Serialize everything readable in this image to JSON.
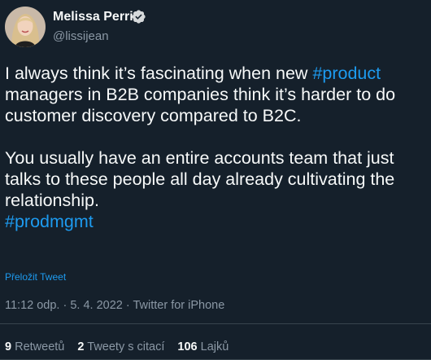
{
  "author": {
    "name": "Melissa Perri",
    "handle": "@lissijean"
  },
  "tweet": {
    "line1": "I always think it’s fascinating when new ",
    "hashtag1": "#product",
    "line1_rest": " managers in B2B companies think it’s harder to do customer discovery compared to B2C.",
    "para2": "You usually have an entire accounts team that just talks to these people all day already cultivating the relationship.",
    "hashtag2": "#prodmgmt"
  },
  "translate_label": "Přeložit Tweet",
  "meta": "11:12 odp. · 5. 4. 2022 · Twitter for iPhone",
  "stats": {
    "retweets_count": "9",
    "retweets_label": "Retweetů",
    "quotes_count": "2",
    "quotes_label": "Tweety s citací",
    "likes_count": "106",
    "likes_label": "Lajků"
  },
  "colors": {
    "background": "#15202b",
    "accent": "#1d9bf0",
    "secondary_text": "#8b98a5",
    "divider": "#38444d"
  },
  "icons": [
    "avatar",
    "verified-badge-icon"
  ]
}
